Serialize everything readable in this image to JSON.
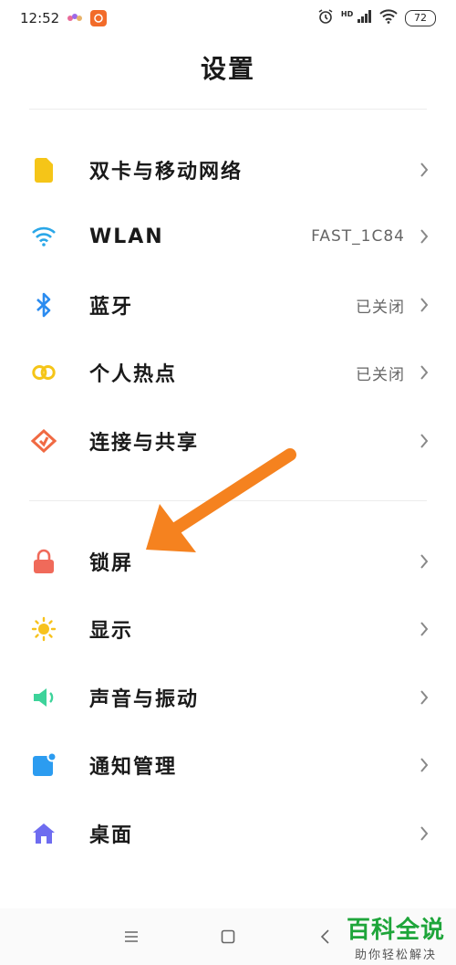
{
  "status_bar": {
    "time": "12:52",
    "battery": "72",
    "network_badge": "HD",
    "icons": [
      "notification-app-icon",
      "orange-app-icon",
      "alarm-icon",
      "signal-icon",
      "wifi-icon",
      "battery-icon"
    ]
  },
  "header": {
    "title": "设置"
  },
  "sections": {
    "network": [
      {
        "label": "双卡与移动网络",
        "value": "",
        "icon": "sim-card-icon",
        "color": "#f5c518"
      },
      {
        "label": "WLAN",
        "value": "FAST_1C84",
        "icon": "wifi-icon",
        "color": "#2aa7e8"
      },
      {
        "label": "蓝牙",
        "value": "已关闭",
        "icon": "bluetooth-icon",
        "color": "#2b8cf0"
      },
      {
        "label": "个人热点",
        "value": "已关闭",
        "icon": "hotspot-icon",
        "color": "#f5c518"
      },
      {
        "label": "连接与共享",
        "value": "",
        "icon": "share-icon",
        "color": "#f06a43"
      }
    ],
    "device": [
      {
        "label": "锁屏",
        "value": "",
        "icon": "lock-icon",
        "color": "#f06a5a"
      },
      {
        "label": "显示",
        "value": "",
        "icon": "sun-icon",
        "color": "#f7c21d"
      },
      {
        "label": "声音与振动",
        "value": "",
        "icon": "speaker-icon",
        "color": "#3dd39a"
      },
      {
        "label": "通知管理",
        "value": "",
        "icon": "notification-icon",
        "color": "#2c9cf0"
      },
      {
        "label": "桌面",
        "value": "",
        "icon": "home-icon",
        "color": "#6e6cf0"
      }
    ]
  },
  "nav": {
    "icons": [
      "menu-icon",
      "home-square-icon",
      "back-icon"
    ]
  },
  "watermark": {
    "title": "百科全说",
    "subtitle": "助你轻松解决"
  },
  "colors": {
    "accent_arrow": "#f5821f",
    "divider": "#ececec"
  }
}
